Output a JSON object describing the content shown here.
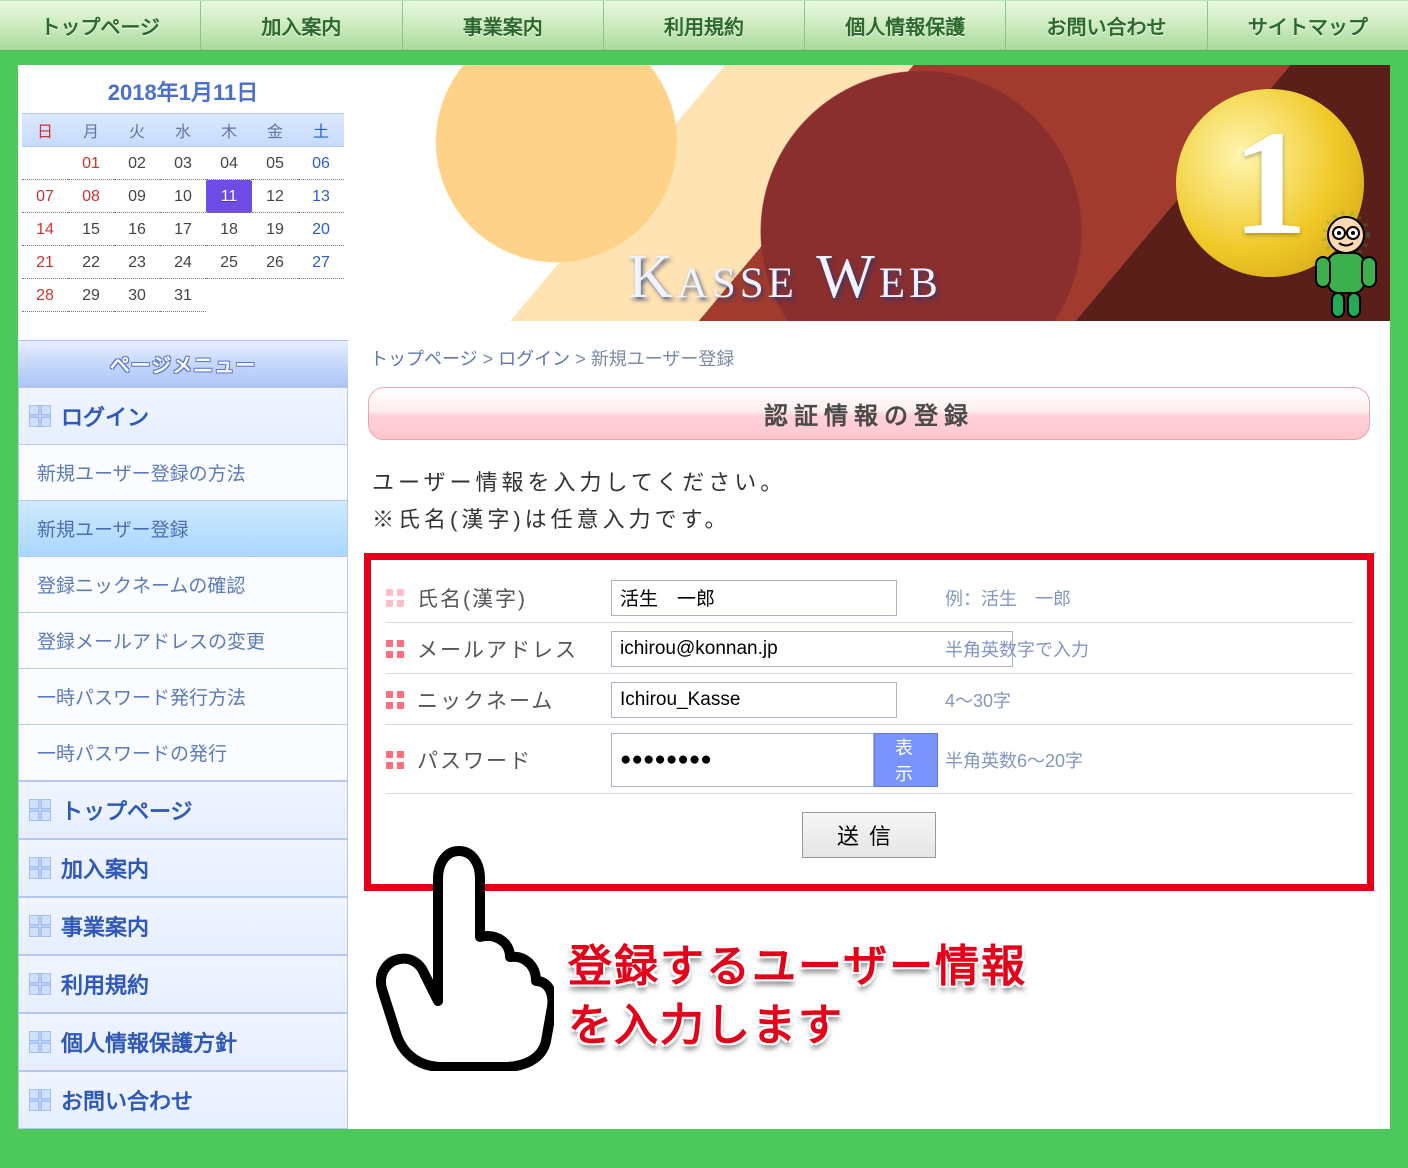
{
  "topnav": [
    "トップページ",
    "加入案内",
    "事業案内",
    "利用規約",
    "個人情報保護",
    "お問い合わせ",
    "サイトマップ"
  ],
  "calendar": {
    "title": "2018年1月11日",
    "dow": [
      "日",
      "月",
      "火",
      "水",
      "木",
      "金",
      "土"
    ],
    "days": [
      {
        "d": "",
        "cls": "empty"
      },
      {
        "d": "01",
        "cls": "holiday"
      },
      {
        "d": "02",
        "cls": ""
      },
      {
        "d": "03",
        "cls": ""
      },
      {
        "d": "04",
        "cls": ""
      },
      {
        "d": "05",
        "cls": ""
      },
      {
        "d": "06",
        "cls": "sat"
      },
      {
        "d": "07",
        "cls": "sun"
      },
      {
        "d": "08",
        "cls": "holiday"
      },
      {
        "d": "09",
        "cls": ""
      },
      {
        "d": "10",
        "cls": ""
      },
      {
        "d": "11",
        "cls": "today"
      },
      {
        "d": "12",
        "cls": ""
      },
      {
        "d": "13",
        "cls": "sat"
      },
      {
        "d": "14",
        "cls": "sun"
      },
      {
        "d": "15",
        "cls": ""
      },
      {
        "d": "16",
        "cls": ""
      },
      {
        "d": "17",
        "cls": ""
      },
      {
        "d": "18",
        "cls": ""
      },
      {
        "d": "19",
        "cls": ""
      },
      {
        "d": "20",
        "cls": "sat"
      },
      {
        "d": "21",
        "cls": "sun"
      },
      {
        "d": "22",
        "cls": ""
      },
      {
        "d": "23",
        "cls": ""
      },
      {
        "d": "24",
        "cls": ""
      },
      {
        "d": "25",
        "cls": ""
      },
      {
        "d": "26",
        "cls": ""
      },
      {
        "d": "27",
        "cls": "sat"
      },
      {
        "d": "28",
        "cls": "sun"
      },
      {
        "d": "29",
        "cls": ""
      },
      {
        "d": "30",
        "cls": ""
      },
      {
        "d": "31",
        "cls": ""
      }
    ]
  },
  "hero": {
    "site_name": "Kasse Web",
    "badge": "1"
  },
  "sidemenu": {
    "title": "ページメニュー",
    "items": [
      {
        "label": "ログイン",
        "type": "header"
      },
      {
        "label": "新規ユーザー登録の方法",
        "type": "sub"
      },
      {
        "label": "新規ユーザー登録",
        "type": "sub",
        "active": true
      },
      {
        "label": "登録ニックネームの確認",
        "type": "sub"
      },
      {
        "label": "登録メールアドレスの変更",
        "type": "sub"
      },
      {
        "label": "一時パスワード発行方法",
        "type": "sub"
      },
      {
        "label": "一時パスワードの発行",
        "type": "sub"
      },
      {
        "label": "トップページ",
        "type": "header"
      },
      {
        "label": "加入案内",
        "type": "header"
      },
      {
        "label": "事業案内",
        "type": "header"
      },
      {
        "label": "利用規約",
        "type": "header"
      },
      {
        "label": "個人情報保護方針",
        "type": "header"
      },
      {
        "label": "お問い合わせ",
        "type": "header"
      }
    ]
  },
  "breadcrumb": {
    "parts": [
      "トップページ",
      "ログイン",
      "新規ユーザー登録"
    ],
    "sep": " > "
  },
  "section_title": "認証情報の登録",
  "instructions_1": "ユーザー情報を入力してください。",
  "instructions_2": "※氏名(漢字)は任意入力です。",
  "form": {
    "name": {
      "label": "氏名(漢字)",
      "value": "活生　一郎",
      "hint": "例：活生　一郎",
      "required": false
    },
    "email": {
      "label": "メールアドレス",
      "value": "ichirou@konnan.jp",
      "hint": "半角英数字で入力",
      "required": true
    },
    "nick": {
      "label": "ニックネーム",
      "value": "Ichirou_Kasse",
      "hint": "4～30字",
      "required": true
    },
    "pass": {
      "label": "パスワード",
      "value": "●●●●●●●●",
      "hint": "半角英数6～20字",
      "required": true,
      "show_btn": "表示"
    }
  },
  "submit_label": "送信",
  "callout": {
    "line1": "登録するユーザー情報",
    "line2": "を入力します"
  }
}
